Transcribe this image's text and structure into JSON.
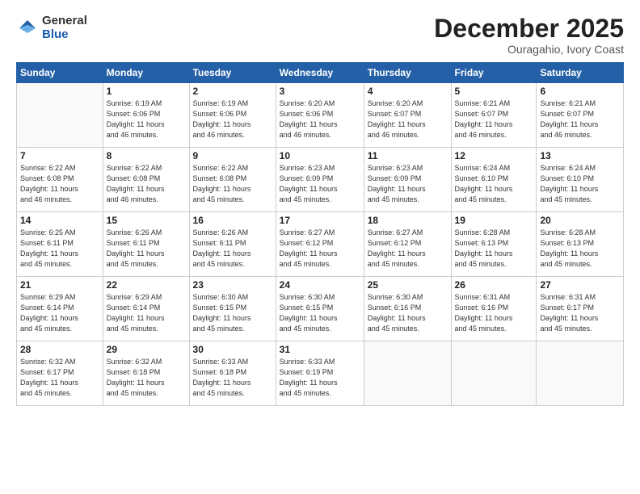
{
  "logo": {
    "general": "General",
    "blue": "Blue"
  },
  "title": "December 2025",
  "subtitle": "Ouragahio, Ivory Coast",
  "header_days": [
    "Sunday",
    "Monday",
    "Tuesday",
    "Wednesday",
    "Thursday",
    "Friday",
    "Saturday"
  ],
  "weeks": [
    [
      {
        "day": "",
        "info": ""
      },
      {
        "day": "1",
        "info": "Sunrise: 6:19 AM\nSunset: 6:06 PM\nDaylight: 11 hours\nand 46 minutes."
      },
      {
        "day": "2",
        "info": "Sunrise: 6:19 AM\nSunset: 6:06 PM\nDaylight: 11 hours\nand 46 minutes."
      },
      {
        "day": "3",
        "info": "Sunrise: 6:20 AM\nSunset: 6:06 PM\nDaylight: 11 hours\nand 46 minutes."
      },
      {
        "day": "4",
        "info": "Sunrise: 6:20 AM\nSunset: 6:07 PM\nDaylight: 11 hours\nand 46 minutes."
      },
      {
        "day": "5",
        "info": "Sunrise: 6:21 AM\nSunset: 6:07 PM\nDaylight: 11 hours\nand 46 minutes."
      },
      {
        "day": "6",
        "info": "Sunrise: 6:21 AM\nSunset: 6:07 PM\nDaylight: 11 hours\nand 46 minutes."
      }
    ],
    [
      {
        "day": "7",
        "info": "Sunrise: 6:22 AM\nSunset: 6:08 PM\nDaylight: 11 hours\nand 46 minutes."
      },
      {
        "day": "8",
        "info": "Sunrise: 6:22 AM\nSunset: 6:08 PM\nDaylight: 11 hours\nand 46 minutes."
      },
      {
        "day": "9",
        "info": "Sunrise: 6:22 AM\nSunset: 6:08 PM\nDaylight: 11 hours\nand 45 minutes."
      },
      {
        "day": "10",
        "info": "Sunrise: 6:23 AM\nSunset: 6:09 PM\nDaylight: 11 hours\nand 45 minutes."
      },
      {
        "day": "11",
        "info": "Sunrise: 6:23 AM\nSunset: 6:09 PM\nDaylight: 11 hours\nand 45 minutes."
      },
      {
        "day": "12",
        "info": "Sunrise: 6:24 AM\nSunset: 6:10 PM\nDaylight: 11 hours\nand 45 minutes."
      },
      {
        "day": "13",
        "info": "Sunrise: 6:24 AM\nSunset: 6:10 PM\nDaylight: 11 hours\nand 45 minutes."
      }
    ],
    [
      {
        "day": "14",
        "info": "Sunrise: 6:25 AM\nSunset: 6:11 PM\nDaylight: 11 hours\nand 45 minutes."
      },
      {
        "day": "15",
        "info": "Sunrise: 6:26 AM\nSunset: 6:11 PM\nDaylight: 11 hours\nand 45 minutes."
      },
      {
        "day": "16",
        "info": "Sunrise: 6:26 AM\nSunset: 6:11 PM\nDaylight: 11 hours\nand 45 minutes."
      },
      {
        "day": "17",
        "info": "Sunrise: 6:27 AM\nSunset: 6:12 PM\nDaylight: 11 hours\nand 45 minutes."
      },
      {
        "day": "18",
        "info": "Sunrise: 6:27 AM\nSunset: 6:12 PM\nDaylight: 11 hours\nand 45 minutes."
      },
      {
        "day": "19",
        "info": "Sunrise: 6:28 AM\nSunset: 6:13 PM\nDaylight: 11 hours\nand 45 minutes."
      },
      {
        "day": "20",
        "info": "Sunrise: 6:28 AM\nSunset: 6:13 PM\nDaylight: 11 hours\nand 45 minutes."
      }
    ],
    [
      {
        "day": "21",
        "info": "Sunrise: 6:29 AM\nSunset: 6:14 PM\nDaylight: 11 hours\nand 45 minutes."
      },
      {
        "day": "22",
        "info": "Sunrise: 6:29 AM\nSunset: 6:14 PM\nDaylight: 11 hours\nand 45 minutes."
      },
      {
        "day": "23",
        "info": "Sunrise: 6:30 AM\nSunset: 6:15 PM\nDaylight: 11 hours\nand 45 minutes."
      },
      {
        "day": "24",
        "info": "Sunrise: 6:30 AM\nSunset: 6:15 PM\nDaylight: 11 hours\nand 45 minutes."
      },
      {
        "day": "25",
        "info": "Sunrise: 6:30 AM\nSunset: 6:16 PM\nDaylight: 11 hours\nand 45 minutes."
      },
      {
        "day": "26",
        "info": "Sunrise: 6:31 AM\nSunset: 6:16 PM\nDaylight: 11 hours\nand 45 minutes."
      },
      {
        "day": "27",
        "info": "Sunrise: 6:31 AM\nSunset: 6:17 PM\nDaylight: 11 hours\nand 45 minutes."
      }
    ],
    [
      {
        "day": "28",
        "info": "Sunrise: 6:32 AM\nSunset: 6:17 PM\nDaylight: 11 hours\nand 45 minutes."
      },
      {
        "day": "29",
        "info": "Sunrise: 6:32 AM\nSunset: 6:18 PM\nDaylight: 11 hours\nand 45 minutes."
      },
      {
        "day": "30",
        "info": "Sunrise: 6:33 AM\nSunset: 6:18 PM\nDaylight: 11 hours\nand 45 minutes."
      },
      {
        "day": "31",
        "info": "Sunrise: 6:33 AM\nSunset: 6:19 PM\nDaylight: 11 hours\nand 45 minutes."
      },
      {
        "day": "",
        "info": ""
      },
      {
        "day": "",
        "info": ""
      },
      {
        "day": "",
        "info": ""
      }
    ]
  ]
}
